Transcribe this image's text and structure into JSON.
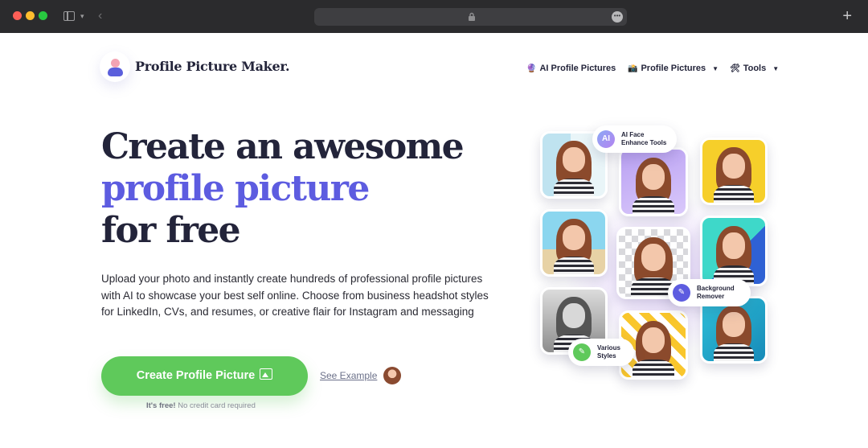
{
  "browser": {
    "url_more_icon": "ellipsis-icon",
    "new_tab_symbol": "+"
  },
  "header": {
    "brand": "Profile Picture Maker.",
    "nav": [
      {
        "icon": "🔮",
        "label": "AI Profile Pictures"
      },
      {
        "icon": "📸",
        "label": "Profile Pictures",
        "caret": "▼"
      },
      {
        "icon": "🛠",
        "label": "Tools",
        "caret": "▼"
      }
    ]
  },
  "hero": {
    "line1": "Create an awesome",
    "line2": "profile picture",
    "line3": "for free",
    "description": "Upload your photo and instantly create hundreds of professional profile pictures with AI to showcase your best self online. Choose from business headshot styles for LinkedIn, CVs, and resumes, or creative flair for Instagram and messaging",
    "cta_label": "Create Profile Picture",
    "see_example": "See Example",
    "free_bold": "It's free!",
    "free_text": "No credit card required"
  },
  "collage": {
    "badges": [
      {
        "icon": "AI",
        "line1": "AI Face",
        "line2": "Enhance Tools"
      },
      {
        "icon": "✎",
        "line1": "Background",
        "line2": "Remover"
      },
      {
        "icon": "✎",
        "line1": "Various",
        "line2": "Styles"
      }
    ]
  },
  "colors": {
    "accent": "#5d5ce0",
    "cta": "#5fc95b",
    "heading": "#23243a"
  }
}
